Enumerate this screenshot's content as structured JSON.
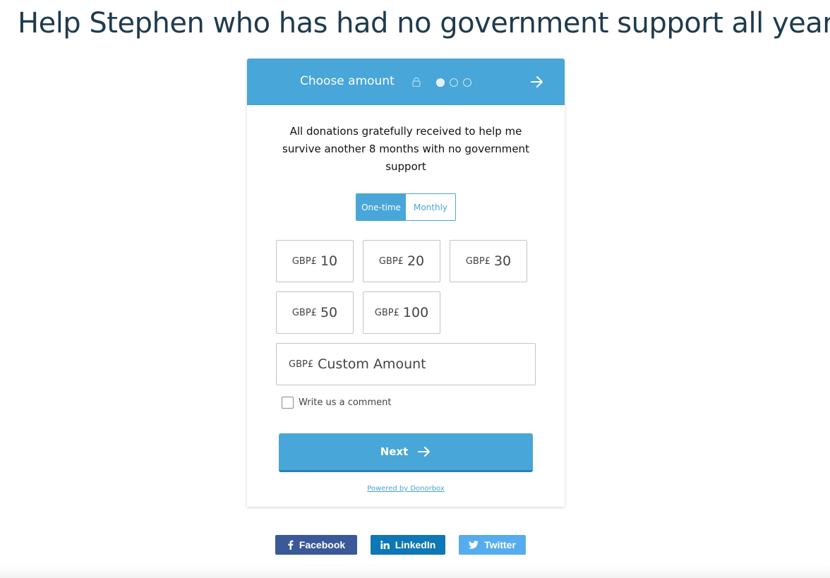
{
  "page": {
    "title": "Help Stephen who has had no government support all year"
  },
  "widget": {
    "header": {
      "title": "Choose amount",
      "steps": {
        "current": 1,
        "total": 3
      }
    },
    "description": "All donations gratefully received to help me survive another 8 months with no government support",
    "frequency": {
      "options": [
        "One-time",
        "Monthly"
      ],
      "selected": "One-time"
    },
    "currency": "GBP£",
    "amounts": [
      "10",
      "20",
      "30",
      "50",
      "100"
    ],
    "custom_amount_placeholder": "Custom Amount",
    "comment_label": "Write us a comment",
    "comment_checked": false,
    "next_label": "Next",
    "powered_by": "Powered by Donorbox"
  },
  "share": {
    "facebook": "Facebook",
    "linkedin": "LinkedIn",
    "twitter": "Twitter"
  },
  "colors": {
    "accent": "#48a6d8",
    "facebook": "#3b5998",
    "linkedin": "#0e77b5",
    "twitter": "#55acee",
    "title": "#1f3b4e"
  },
  "icons": [
    "lock-icon",
    "arrow-right-icon",
    "facebook-icon",
    "linkedin-icon",
    "twitter-icon"
  ]
}
